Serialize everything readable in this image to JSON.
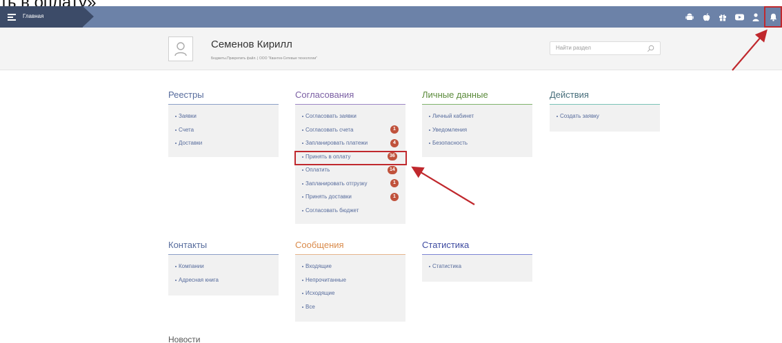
{
  "caption_text": "ть в оплату»",
  "topbar": {
    "home_label": "Главная",
    "icons": [
      "android-icon",
      "apple-icon",
      "gift-icon",
      "youtube-icon",
      "user-icon",
      "bell-icon"
    ]
  },
  "header": {
    "user_name": "Семенов Кирилл",
    "user_sub": "Бюджеты.Прикрепить файл. | ООО \"Квантек-Сетевые технологии\"",
    "search_placeholder": "Найти раздел"
  },
  "sections": {
    "registries": {
      "title": "Реестры",
      "items": [
        "Заявки",
        "Счета",
        "Доставки"
      ]
    },
    "approvals": {
      "title": "Согласования",
      "items": [
        {
          "label": "Согласовать заявки",
          "badge": ""
        },
        {
          "label": "Согласовать счета",
          "badge": "1"
        },
        {
          "label": "Запланировать платежи",
          "badge": "4"
        },
        {
          "label": "Принять в оплату",
          "badge": "36"
        },
        {
          "label": "Оплатить",
          "badge": "14"
        },
        {
          "label": "Запланировать отгрузку",
          "badge": "1"
        },
        {
          "label": "Принять доставки",
          "badge": "1"
        },
        {
          "label": "Согласовать бюджет",
          "badge": ""
        }
      ]
    },
    "personal": {
      "title": "Личные данные",
      "items": [
        "Личный кабинет",
        "Уведомления",
        "Безопасность"
      ]
    },
    "actions": {
      "title": "Действия",
      "items": [
        "Создать заявку"
      ]
    },
    "contacts": {
      "title": "Контакты",
      "items": [
        "Компании",
        "Адресная книга"
      ]
    },
    "messages": {
      "title": "Сообщения",
      "items": [
        "Входящие",
        "Непрочитанные",
        "Исходящие",
        "Все"
      ]
    },
    "statistics": {
      "title": "Статистика",
      "items": [
        "Статистика"
      ]
    }
  },
  "news_title": "Новости",
  "colors": {
    "topbar": "#6c82a8",
    "home_tab": "#3c4b68",
    "badge": "#c0523c",
    "annotation_red": "#c0282d",
    "link": "#566b9c"
  }
}
